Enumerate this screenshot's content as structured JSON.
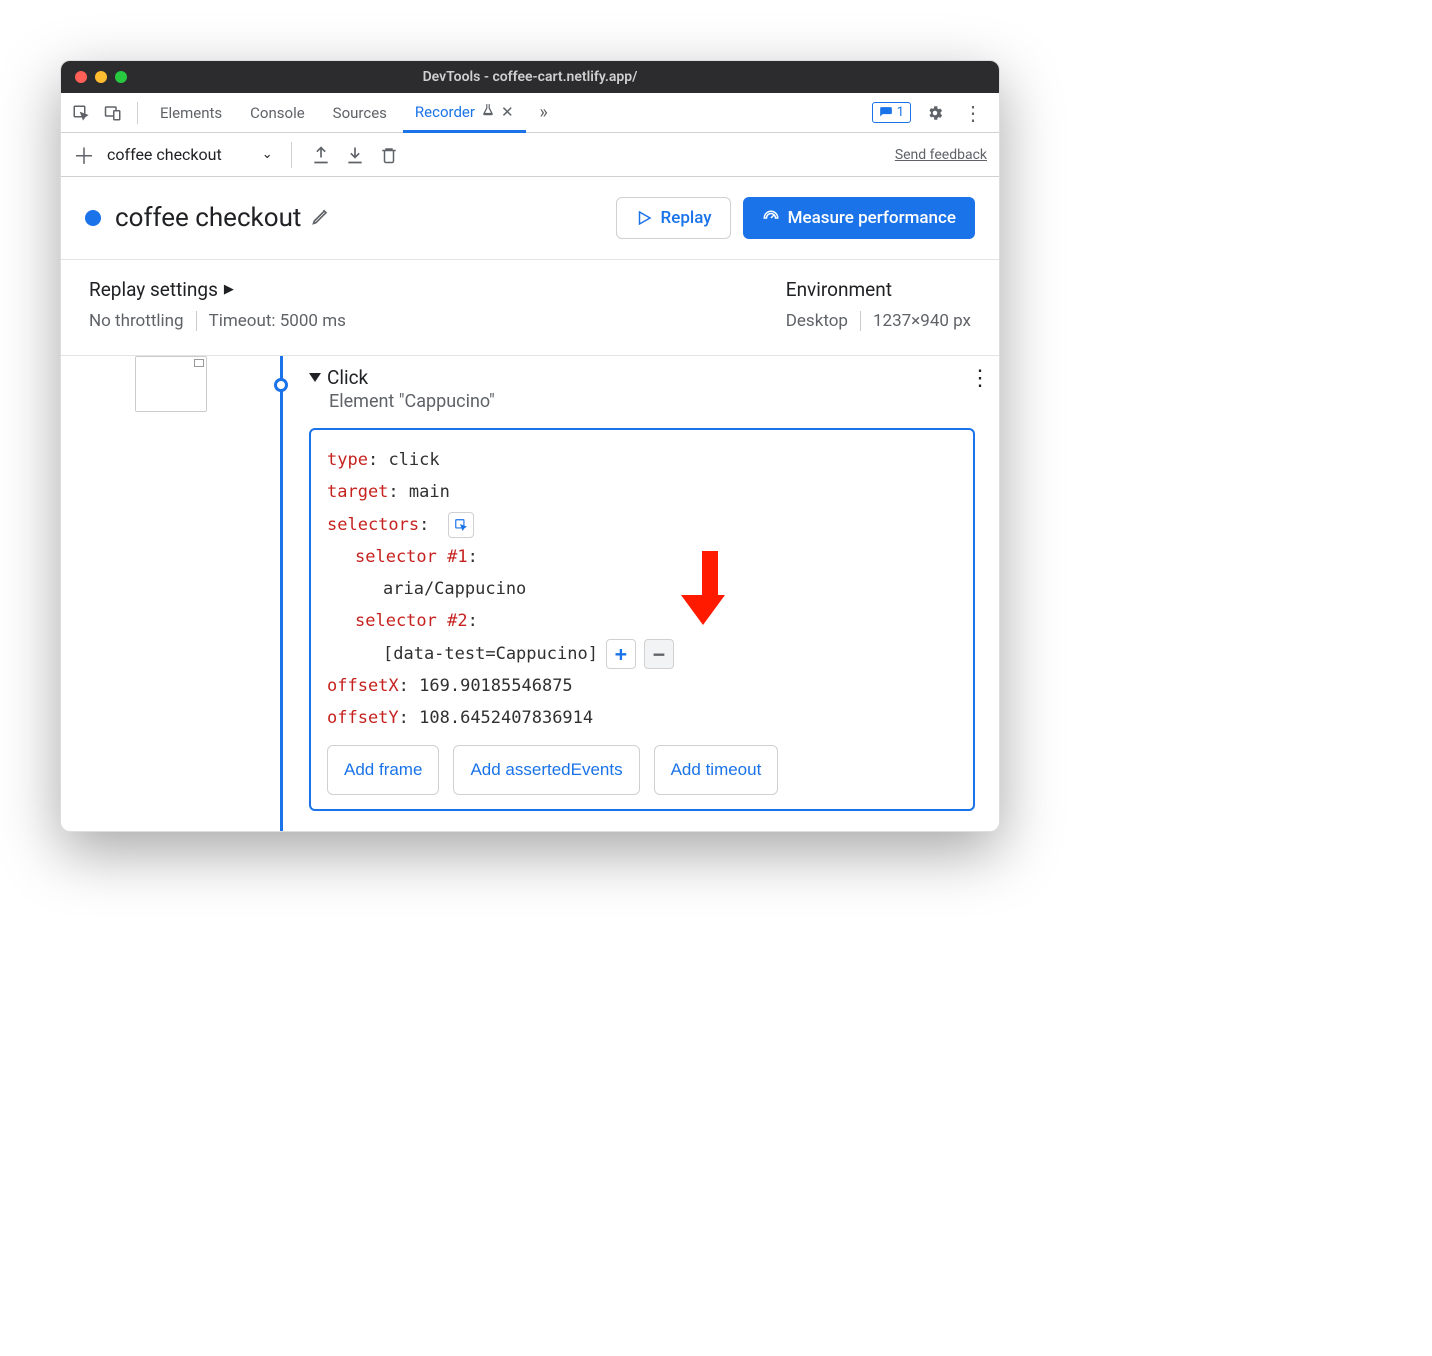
{
  "window": {
    "title": "DevTools - coffee-cart.netlify.app/"
  },
  "tabs": {
    "items": [
      "Elements",
      "Console",
      "Sources",
      "Recorder"
    ],
    "active": "Recorder",
    "issues_count": "1"
  },
  "toolbar": {
    "recording_name": "coffee checkout",
    "send_feedback": "Send feedback"
  },
  "header": {
    "title": "coffee checkout",
    "replay_label": "Replay",
    "measure_label": "Measure performance"
  },
  "settings": {
    "replay_title": "Replay settings",
    "throttling": "No throttling",
    "timeout": "Timeout: 5000 ms",
    "env_title": "Environment",
    "device": "Desktop",
    "viewport": "1237×940 px"
  },
  "step": {
    "name": "Click",
    "subtitle": "Element \"Cappucino\"",
    "detail": {
      "type_key": "type",
      "type_val": "click",
      "target_key": "target",
      "target_val": "main",
      "selectors_key": "selectors",
      "sel1_key": "selector #1",
      "sel1_val": "aria/Cappucino",
      "sel2_key": "selector #2",
      "sel2_val": "[data-test=Cappucino]",
      "offsetX_key": "offsetX",
      "offsetX_val": "169.90185546875",
      "offsetY_key": "offsetY",
      "offsetY_val": "108.6452407836914"
    },
    "actions": {
      "add_frame": "Add frame",
      "add_asserted": "Add assertedEvents",
      "add_timeout": "Add timeout"
    }
  }
}
